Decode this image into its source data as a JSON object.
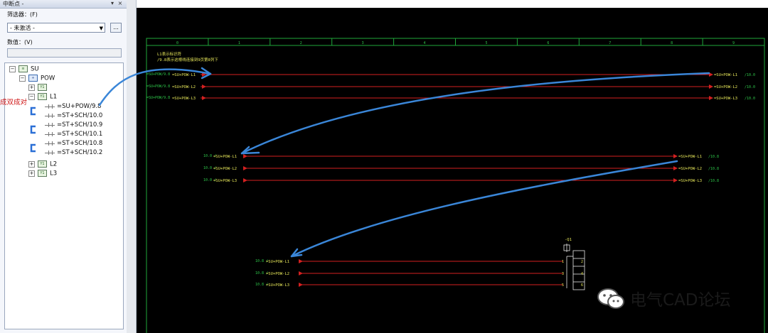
{
  "panel": {
    "title": "中断点 - ",
    "filter_label": "筛选器：(F)",
    "filter_value": "- 未激活 -",
    "more_button": "...",
    "values_label": "数值：(V)",
    "values_input": ""
  },
  "tree": {
    "root": "SU",
    "pow": "POW",
    "l1": "L1",
    "l2": "L2",
    "l3": "L3",
    "items": [
      "=SU+POW/9.8",
      "=ST+SCH/10.0",
      "=ST+SCH/10.9",
      "=ST+SCH/10.1",
      "=ST+SCH/10.8",
      "=ST+SCH/10.2"
    ],
    "annotation": "成双成对"
  },
  "schematic": {
    "column_numbers": [
      "0",
      "1",
      "2",
      "3",
      "4",
      "5",
      "6",
      "7",
      "8",
      "9"
    ],
    "note_line1": "L1表示标识符",
    "note_line2": "/9.8表示这根线连接到9页第8列下",
    "group1_left_refs": [
      "=SU+POW/9.8",
      "=SU+POW/9.8",
      "=SU+POW/9.8"
    ],
    "group1_labels": [
      "=SU+POW-L1",
      "=SU+POW-L2",
      "=SU+POW-L3"
    ],
    "group1_right_labels": [
      "=SU+POW-L1",
      "=SU+POW-L2",
      "=SU+POW-L3"
    ],
    "group1_right_refs": [
      "/10.0",
      "/10.0",
      "/10.0"
    ],
    "group2_left_refs": [
      "10.0 /",
      "10.0 /",
      "10.0 /"
    ],
    "group2_labels": [
      "=SU+POW-L1",
      "=SU+POW-L2",
      "=SU+POW-L3"
    ],
    "group2_right_labels": [
      "=SU+POW-L1",
      "=SU+POW-L2",
      "=SU+POW-L3"
    ],
    "group2_right_refs": [
      "/10.8",
      "/10.8",
      "/10.8"
    ],
    "group3_left_refs": [
      "10.8 /",
      "10.8 /",
      "10.8 /"
    ],
    "group3_labels": [
      "=SU+POW-L1",
      "=SU+POW-L2",
      "=SU+POW-L3"
    ],
    "breaker_tag": "-Q1",
    "terminal_numbers": [
      "1",
      "3",
      "5",
      "2",
      "4",
      "6"
    ]
  },
  "watermark": "电气CAD论坛",
  "colors": {
    "canvas_bg": "#000000",
    "wire": "#d42020",
    "frame": "#1fa83a",
    "label": "#e8e85a",
    "annotation_arrow": "#3a86d8"
  }
}
